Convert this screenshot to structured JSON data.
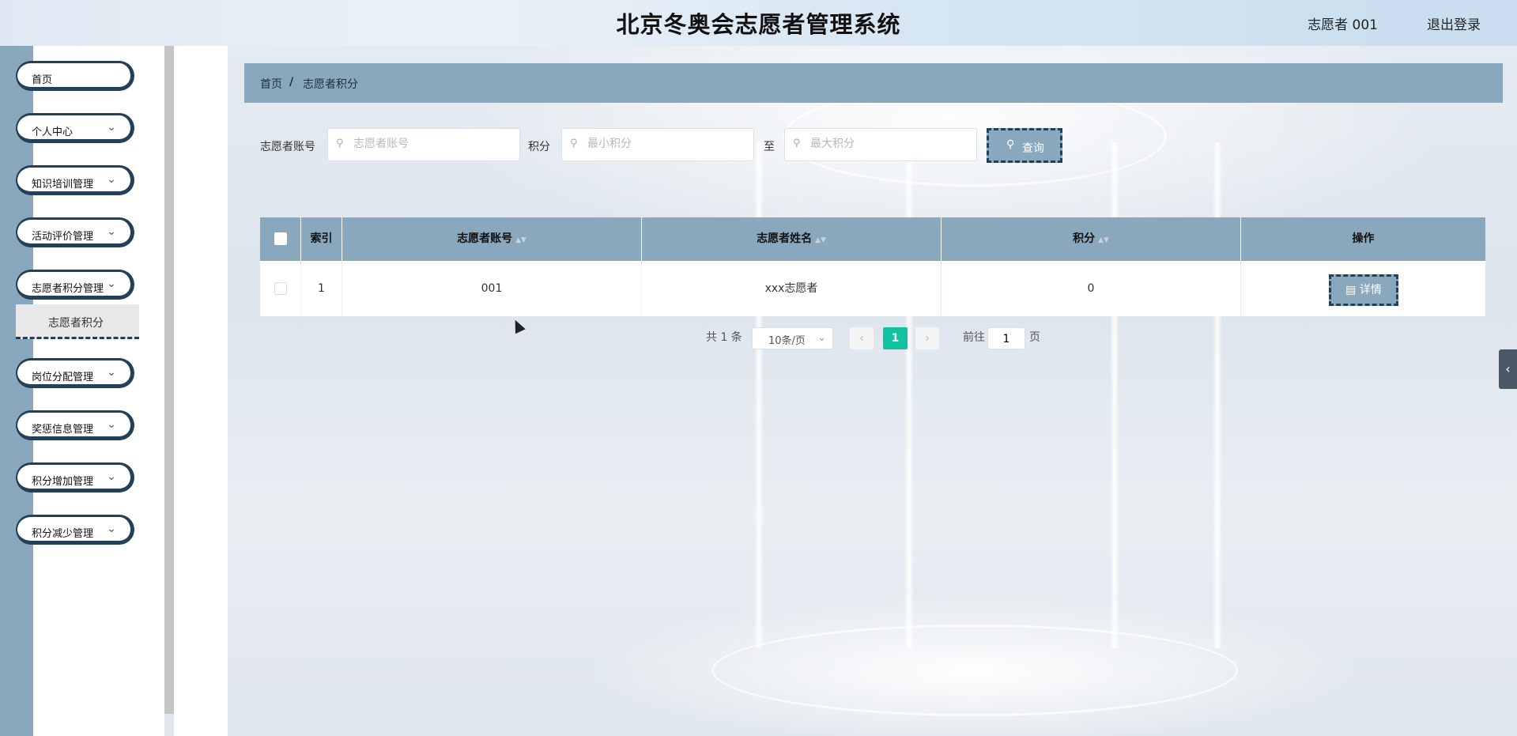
{
  "header": {
    "title": "北京冬奥会志愿者管理系统",
    "user": "志愿者 001",
    "logout": "退出登录"
  },
  "sidebar": {
    "items": [
      {
        "label": "首页",
        "has_children": false
      },
      {
        "label": "个人中心",
        "has_children": true
      },
      {
        "label": "知识培训管理",
        "has_children": true
      },
      {
        "label": "活动评价管理",
        "has_children": true
      },
      {
        "label": "志愿者积分管理",
        "has_children": true
      },
      {
        "label": "岗位分配管理",
        "has_children": true
      },
      {
        "label": "奖惩信息管理",
        "has_children": true
      },
      {
        "label": "积分增加管理",
        "has_children": true
      },
      {
        "label": "积分减少管理",
        "has_children": true
      }
    ],
    "submenu_active": "志愿者积分"
  },
  "breadcrumb": {
    "home": "首页",
    "separator": "/",
    "current": "志愿者积分"
  },
  "search": {
    "account_label": "志愿者账号",
    "account_placeholder": "志愿者账号",
    "score_label": "积分",
    "min_placeholder": "最小积分",
    "to_label": "至",
    "max_placeholder": "最大积分",
    "query_button": "查询"
  },
  "table": {
    "columns": [
      "索引",
      "志愿者账号",
      "志愿者姓名",
      "积分",
      "操作"
    ],
    "rows": [
      {
        "index": "1",
        "account": "001",
        "name": "xxx志愿者",
        "score": "0",
        "action": "详情"
      }
    ]
  },
  "pagination": {
    "total": "共 1 条",
    "page_size": "10条/页",
    "current_page": "1",
    "goto_label": "前往",
    "goto_value": "1",
    "page_suffix": "页"
  },
  "colors": {
    "accent": "#8aa8bd",
    "dark_border": "#234058",
    "active_page": "#13c2a0"
  }
}
